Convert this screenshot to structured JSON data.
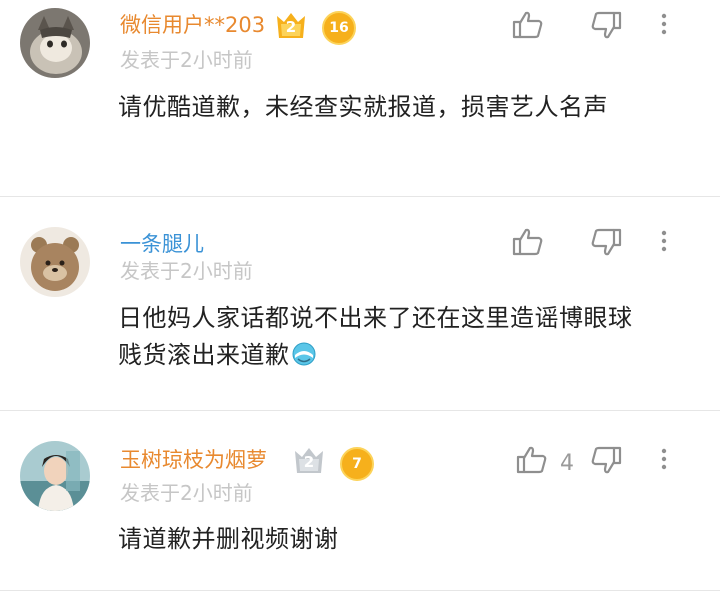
{
  "comments": [
    {
      "username": "微信用户**203",
      "level": "2",
      "fans_level": "16",
      "time": "发表于2小时前",
      "body": "请优酷道歉，未经查实就报道，损害艺人名声",
      "likes": ""
    },
    {
      "username": "一条腿儿",
      "time": "发表于2小时前",
      "body": "日他妈人家话都说不出来了还在这里造谣博眼球  贱货滚出来道歉",
      "likes": ""
    },
    {
      "username": "玉树琼枝为烟萝",
      "level": "2",
      "fans_level": "7",
      "time": "发表于2小时前",
      "body": "请道歉并删视频谢谢",
      "likes": "4"
    }
  ],
  "icons": {
    "like": "thumbs-up-icon",
    "dislike": "thumbs-down-icon",
    "more": "more-vertical-icon"
  },
  "colors": {
    "username_orange": "#e8892f",
    "username_blue": "#3a92d6",
    "meta_gray": "#c6c6c6",
    "badge_gold": "#f6b01c"
  }
}
